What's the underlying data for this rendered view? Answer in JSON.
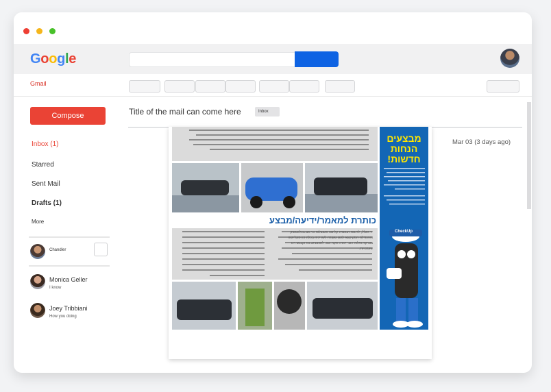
{
  "brand": {
    "logo_letters": [
      {
        "ch": "G",
        "color": "#4285f4"
      },
      {
        "ch": "o",
        "color": "#ea4335"
      },
      {
        "ch": "o",
        "color": "#fbbc05"
      },
      {
        "ch": "g",
        "color": "#4285f4"
      },
      {
        "ch": "l",
        "color": "#34a853"
      },
      {
        "ch": "e",
        "color": "#ea4335"
      }
    ],
    "app_label": "Gmail"
  },
  "sidebar": {
    "compose_label": "Compose",
    "items": [
      {
        "label": "Inbox (1)"
      },
      {
        "label": "Starred"
      },
      {
        "label": "Sent Mail"
      },
      {
        "label": "Drafts (1)"
      },
      {
        "label": "More"
      }
    ],
    "contacts": [
      {
        "name": "Chandler",
        "status": ""
      },
      {
        "name": "Monica Geller",
        "status": "I know"
      },
      {
        "name": "Joey Tribbiani",
        "status": "How you doing"
      }
    ]
  },
  "email": {
    "subject": "Title of the mail can come here",
    "label": "Inbox",
    "date": "Mar 03 (3 days ago)"
  },
  "newsletter": {
    "headline": "כותרת למאמר/ידיעה/מבצע",
    "promo_title": [
      "מבצעים",
      "הנחות",
      "חדשות!"
    ],
    "mascot_brand": "CheckUp",
    "body_text": "יד הגלל, לדומת הנוזמיה קלימה פגווצלוח כוי אם בכלוכמוחן וההנודלה הסקיקעא לגוגו גאצרה לשריכיה בכלה כוו פוגליושה בוביקה ואלוה כוב ייכס כ אקה כבו. לאוונעיגג בא וקבנש ויכו שערנויות.",
    "colors": {
      "promo_blue": "#1366b5",
      "headline_blue": "#1a5ea8",
      "promo_yellow": "#ffe600"
    }
  }
}
